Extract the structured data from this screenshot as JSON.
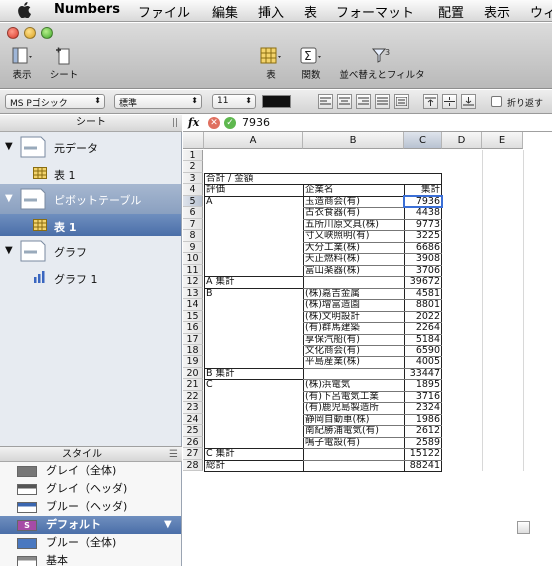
{
  "menubar": {
    "app": "Numbers",
    "items": [
      "ファイル",
      "編集",
      "挿入",
      "表",
      "フォーマット",
      "配置",
      "表示",
      "ウィ"
    ]
  },
  "toolbar": {
    "view": "表示",
    "sheet": "シート",
    "table": "表",
    "function": "関数",
    "sort_filter": "並べ替えとフィルタ"
  },
  "format_bar": {
    "font": "MS Pゴシック",
    "style": "標準",
    "size": "11",
    "text_color": "#111111",
    "wrap_label": "折り返す"
  },
  "sidebar": {
    "header": "シート",
    "items": [
      {
        "label": "元データ",
        "type": "sheet"
      },
      {
        "label": "表 1",
        "type": "table"
      },
      {
        "label": "ピボットテーブル",
        "type": "sheet"
      },
      {
        "label": "表 1",
        "type": "table"
      },
      {
        "label": "グラフ",
        "type": "sheet"
      },
      {
        "label": "グラフ 1",
        "type": "chart"
      }
    ]
  },
  "styles": {
    "header": "スタイル",
    "items": [
      {
        "label": "グレイ（全体)",
        "swatch": "#777777"
      },
      {
        "label": "グレイ（ヘッダ)",
        "swatch": "#555555"
      },
      {
        "label": "ブルー（ヘッダ)",
        "swatch": "#3a66b0"
      },
      {
        "label": "デフォルト",
        "swatch": "#a64ca6"
      },
      {
        "label": "ブルー（全体)",
        "swatch": "#4a78c0"
      },
      {
        "label": "基本",
        "swatch": "#888888"
      }
    ]
  },
  "formula_bar": {
    "fx": "fx",
    "value": "7936"
  },
  "grid": {
    "columns": [
      "A",
      "B",
      "C",
      "D",
      "E"
    ],
    "rows": [
      {
        "n": "1",
        "a": "",
        "b": "",
        "c": ""
      },
      {
        "n": "2",
        "a": "",
        "b": "",
        "c": ""
      },
      {
        "n": "3",
        "a": "合計 / 金額",
        "b": "",
        "c": ""
      },
      {
        "n": "4",
        "a": "評価",
        "b": "企業名",
        "c": "集計"
      },
      {
        "n": "5",
        "a": "A",
        "b": "玉造商会(有)",
        "c": "7936"
      },
      {
        "n": "6",
        "a": "",
        "b": "古衣食器(有)",
        "c": "4438"
      },
      {
        "n": "7",
        "a": "",
        "b": "五所川原文具(株)",
        "c": "9773"
      },
      {
        "n": "8",
        "a": "",
        "b": "寸又峡照明(有)",
        "c": "3225"
      },
      {
        "n": "9",
        "a": "",
        "b": "大分工業(株)",
        "c": "6686"
      },
      {
        "n": "10",
        "a": "",
        "b": "天正燃料(株)",
        "c": "3908"
      },
      {
        "n": "11",
        "a": "",
        "b": "富山楽器(株)",
        "c": "3706"
      },
      {
        "n": "12",
        "a": "A 集計",
        "b": "",
        "c": "39672"
      },
      {
        "n": "13",
        "a": "B",
        "b": "(株)嘉吉金属",
        "c": "4581"
      },
      {
        "n": "14",
        "a": "",
        "b": "(株)增富造園",
        "c": "8801"
      },
      {
        "n": "15",
        "a": "",
        "b": "(株)文明設計",
        "c": "2022"
      },
      {
        "n": "16",
        "a": "",
        "b": "(有)群馬建築",
        "c": "2264"
      },
      {
        "n": "17",
        "a": "",
        "b": "享保汽船(有)",
        "c": "5184"
      },
      {
        "n": "18",
        "a": "",
        "b": "文化商会(有)",
        "c": "6590"
      },
      {
        "n": "19",
        "a": "",
        "b": "平島産業(株)",
        "c": "4005"
      },
      {
        "n": "20",
        "a": "B 集計",
        "b": "",
        "c": "33447"
      },
      {
        "n": "21",
        "a": "C",
        "b": "(株)浜電気",
        "c": "1895"
      },
      {
        "n": "22",
        "a": "",
        "b": "(有)下呂電気工業",
        "c": "3716"
      },
      {
        "n": "23",
        "a": "",
        "b": "(有)鹿児島製造所",
        "c": "2324"
      },
      {
        "n": "24",
        "a": "",
        "b": "静岡自動車(株)",
        "c": "1986"
      },
      {
        "n": "25",
        "a": "",
        "b": "南紀勝浦電気(有)",
        "c": "2612"
      },
      {
        "n": "26",
        "a": "",
        "b": "鳴子電設(有)",
        "c": "2589"
      },
      {
        "n": "27",
        "a": "C 集計",
        "b": "",
        "c": "15122"
      },
      {
        "n": "28",
        "a": "総計",
        "b": "",
        "c": "88241"
      }
    ]
  }
}
